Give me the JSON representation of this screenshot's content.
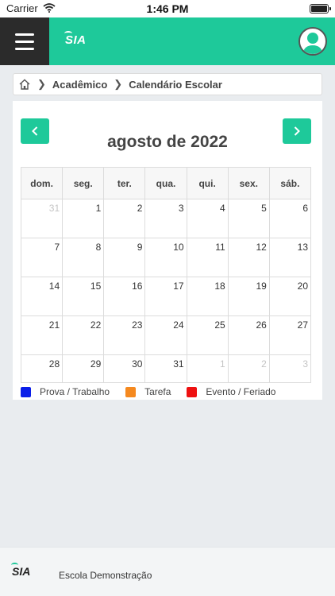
{
  "status_bar": {
    "carrier": "Carrier",
    "time": "1:46 PM"
  },
  "header": {
    "logo": "SIA",
    "brand_color": "#1ec99a"
  },
  "breadcrumb": {
    "items": [
      "Acadêmico",
      "Calendário Escolar"
    ]
  },
  "calendar": {
    "title": "agosto de 2022",
    "weekdays": [
      "dom.",
      "seg.",
      "ter.",
      "qua.",
      "qui.",
      "sex.",
      "sáb."
    ],
    "weeks": [
      [
        {
          "d": "31",
          "other": true
        },
        {
          "d": "1"
        },
        {
          "d": "2"
        },
        {
          "d": "3"
        },
        {
          "d": "4"
        },
        {
          "d": "5"
        },
        {
          "d": "6"
        }
      ],
      [
        {
          "d": "7"
        },
        {
          "d": "8"
        },
        {
          "d": "9"
        },
        {
          "d": "10"
        },
        {
          "d": "11"
        },
        {
          "d": "12"
        },
        {
          "d": "13"
        }
      ],
      [
        {
          "d": "14"
        },
        {
          "d": "15"
        },
        {
          "d": "16"
        },
        {
          "d": "17"
        },
        {
          "d": "18"
        },
        {
          "d": "19"
        },
        {
          "d": "20"
        }
      ],
      [
        {
          "d": "21"
        },
        {
          "d": "22"
        },
        {
          "d": "23"
        },
        {
          "d": "24"
        },
        {
          "d": "25"
        },
        {
          "d": "26"
        },
        {
          "d": "27"
        }
      ],
      [
        {
          "d": "28"
        },
        {
          "d": "29"
        },
        {
          "d": "30"
        },
        {
          "d": "31"
        },
        {
          "d": "1",
          "other": true
        },
        {
          "d": "2",
          "other": true
        },
        {
          "d": "3",
          "other": true
        }
      ]
    ]
  },
  "legend": [
    {
      "label": "Prova / Trabalho",
      "color": "#0a1ee8"
    },
    {
      "label": "Tarefa",
      "color": "#f5891f"
    },
    {
      "label": "Evento / Feriado",
      "color": "#ee1111"
    }
  ],
  "footer": {
    "logo": "SIA",
    "school": "Escola Demonstração"
  }
}
